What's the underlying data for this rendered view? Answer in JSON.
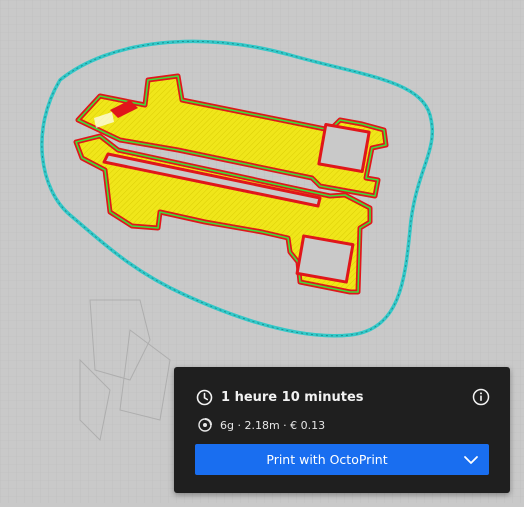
{
  "viewport": {
    "icon": "3d-print-layer-view",
    "colors": {
      "background": "#c9c9c9",
      "skirt": "#33c8c8",
      "outer_wall": "#e0161a",
      "inner_wall": "#3ee03a",
      "infill": "#f0e61a"
    }
  },
  "print_panel": {
    "time_icon": "clock-icon",
    "print_time": "1 heure 10 minutes",
    "info_icon": "info-icon",
    "material_icon": "spool-icon",
    "material_stats": "6g · 2.18m · € 0.13",
    "print_button_label": "Print with OctoPrint",
    "dropdown_icon": "chevron-down-icon",
    "colors": {
      "panel": "#1f1f1f",
      "button": "#196ef0"
    }
  }
}
